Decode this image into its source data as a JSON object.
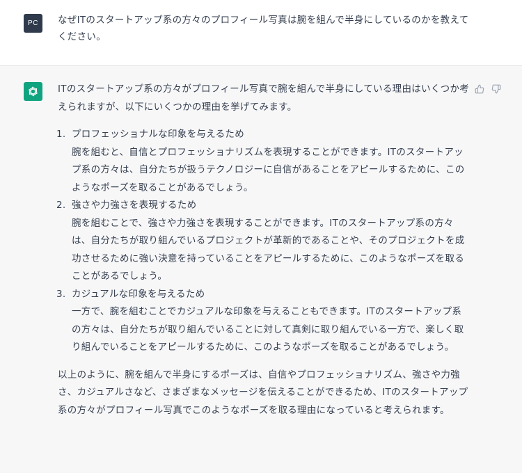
{
  "user_message": {
    "avatar_initials": "PC",
    "text": "なぜITのスタートアップ系の方々のプロフィール写真は腕を組んで半身にしているのかを教えてください。"
  },
  "assistant_message": {
    "avatar_icon": "openai-logo-icon",
    "intro": "ITのスタートアップ系の方々がプロフィール写真で腕を組んで半身にしている理由はいくつか考えられますが、以下にいくつかの理由を挙げてみます。",
    "items": [
      {
        "number": "1.",
        "title": "プロフェッショナルな印象を与えるため",
        "body": "腕を組むと、自信とプロフェッショナリズムを表現することができます。ITのスタートアップ系の方々は、自分たちが扱うテクノロジーに自信があることをアピールするために、このようなポーズを取ることがあるでしょう。"
      },
      {
        "number": "2.",
        "title": "強さや力強さを表現するため",
        "body": "腕を組むことで、強さや力強さを表現することができます。ITのスタートアップ系の方々は、自分たちが取り組んでいるプロジェクトが革新的であることや、そのプロジェクトを成功させるために強い決意を持っていることをアピールするために、このようなポーズを取ることがあるでしょう。"
      },
      {
        "number": "3.",
        "title": "カジュアルな印象を与えるため",
        "body": "一方で、腕を組むことでカジュアルな印象を与えることもできます。ITのスタートアップ系の方々は、自分たちが取り組んでいることに対して真剣に取り組んでいる一方で、楽しく取り組んでいることをアピールするために、このようなポーズを取ることがあるでしょう。"
      }
    ],
    "outro": "以上のように、腕を組んで半身にするポーズは、自信やプロフェッショナリズム、強さや力強さ、カジュアルさなど、さまざまなメッセージを伝えることができるため、ITのスタートアップ系の方々がプロフィール写真でこのようなポーズを取る理由になっていると考えられます。",
    "feedback": {
      "thumbs_up_icon": "thumbs-up-icon",
      "thumbs_down_icon": "thumbs-down-icon"
    }
  },
  "colors": {
    "user_avatar_bg": "#2f3b4c",
    "assistant_avatar_bg": "#10a37f",
    "assistant_row_bg": "#f7f7f8",
    "text": "#374151"
  }
}
